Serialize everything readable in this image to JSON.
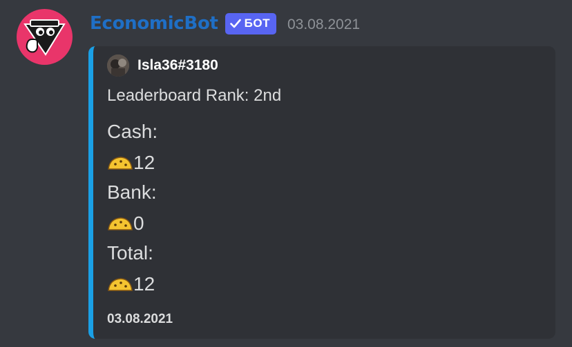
{
  "message": {
    "author": "EconomicBot",
    "bot_tag": "БОТ",
    "timestamp": "03.08.2021"
  },
  "embed": {
    "author_name": "Isla36#3180",
    "description": "Leaderboard Rank: 2nd",
    "fields": [
      {
        "label": "Cash:",
        "value": "12"
      },
      {
        "label": "Bank:",
        "value": "0"
      },
      {
        "label": "Total:",
        "value": "12"
      }
    ],
    "footer": "03.08.2021",
    "accent_color": "#1aa0e6"
  },
  "colors": {
    "username": "#1f6fc6",
    "bot_tag": "#5865f2",
    "avatar_bg": "#e9356a"
  },
  "icons": {
    "currency": "taco-coin-icon",
    "verified": "checkmark-icon"
  }
}
